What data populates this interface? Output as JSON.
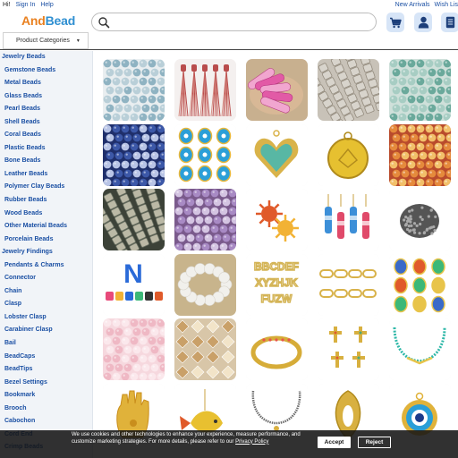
{
  "topbar": {
    "greeting": "Hi!",
    "sign_in": "Sign In",
    "help": "Help",
    "new_arrivals": "New Arrivals",
    "wish_list": "Wish Lis"
  },
  "header": {
    "logo_part1": "And",
    "logo_part2": "Bead",
    "search_placeholder": "",
    "icons": [
      "cart-icon",
      "user-icon",
      "order-list-icon"
    ]
  },
  "category_button": {
    "label": "Product Categories",
    "icon": "chevron-down-icon"
  },
  "sidebar": {
    "items": [
      {
        "label": "Jewelry Beads",
        "type": "group"
      },
      {
        "label": "Gemstone Beads",
        "type": "sub"
      },
      {
        "label": "Metal Beads",
        "type": "sub"
      },
      {
        "label": "Glass Beads",
        "type": "sub"
      },
      {
        "label": "Pearl Beads",
        "type": "sub"
      },
      {
        "label": "Shell Beads",
        "type": "sub"
      },
      {
        "label": "Coral Beads",
        "type": "sub"
      },
      {
        "label": "Plastic Beads",
        "type": "sub"
      },
      {
        "label": "Bone Beads",
        "type": "sub"
      },
      {
        "label": "Leather Beads",
        "type": "sub"
      },
      {
        "label": "Polymer Clay Beads",
        "type": "sub"
      },
      {
        "label": "Rubber Beads",
        "type": "sub"
      },
      {
        "label": "Wood Beads",
        "type": "sub"
      },
      {
        "label": "Other Material Beads",
        "type": "sub"
      },
      {
        "label": "Porcelain Beads",
        "type": "sub"
      },
      {
        "label": "Jewelry Findings",
        "type": "group"
      },
      {
        "label": "Pendants & Charms",
        "type": "sub"
      },
      {
        "label": "Connector",
        "type": "sub"
      },
      {
        "label": "Chain",
        "type": "sub"
      },
      {
        "label": "Clasp",
        "type": "sub"
      },
      {
        "label": "Lobster Clasp",
        "type": "sub"
      },
      {
        "label": "Carabiner Clasp",
        "type": "sub"
      },
      {
        "label": "Bail",
        "type": "sub"
      },
      {
        "label": "BeadCaps",
        "type": "sub"
      },
      {
        "label": "BeadTips",
        "type": "sub"
      },
      {
        "label": "Bezel Settings",
        "type": "sub"
      },
      {
        "label": "Bookmark",
        "type": "sub"
      },
      {
        "label": "Brooch",
        "type": "sub"
      },
      {
        "label": "Cabochon",
        "type": "sub"
      },
      {
        "label": "Cord End",
        "type": "sub"
      },
      {
        "label": "Crimp Beads",
        "type": "sub"
      }
    ]
  },
  "products": [
    {
      "kind": "beads",
      "bg": "#e9eef0",
      "c1": "#8fb3c2",
      "c2": "#b9cfd8"
    },
    {
      "kind": "tassels",
      "bg": "#f4f0ef",
      "c1": "#b94c4c",
      "c2": "#d78f86"
    },
    {
      "kind": "tubes",
      "bg": "#c8b08f",
      "c1": "#e25aa6",
      "c2": "#f1a6cf"
    },
    {
      "kind": "glass",
      "bg": "#c8c2b8",
      "c1": "#dad6cf",
      "c2": "#8e8678"
    },
    {
      "kind": "beads",
      "bg": "#cfe0da",
      "c1": "#6aa99b",
      "c2": "#a7cdc3"
    },
    {
      "kind": "beads",
      "bg": "#1f2f6b",
      "c1": "#3c58a8",
      "c2": "#b8c4e6"
    },
    {
      "kind": "charms",
      "bg": "#ffffff",
      "c1": "#2b9fd8",
      "c2": "#e8b73a"
    },
    {
      "kind": "heart",
      "bg": "#ffffff",
      "c1": "#d9b34a",
      "c2": "#58b7a4"
    },
    {
      "kind": "coin",
      "bg": "#ffffff",
      "c1": "#e6c030",
      "c2": "#b08a1c"
    },
    {
      "kind": "beads",
      "bg": "#b94b2c",
      "c1": "#e58a3c",
      "c2": "#f2c06a"
    },
    {
      "kind": "glass",
      "bg": "#3c4238",
      "c1": "#c9c6b2",
      "c2": "#6e7567"
    },
    {
      "kind": "beads",
      "bg": "#7a5a8c",
      "c1": "#a88ac4",
      "c2": "#d4c4e2"
    },
    {
      "kind": "sun",
      "bg": "#ffffff",
      "c1": "#e05a2a",
      "c2": "#f2b234"
    },
    {
      "kind": "bottles",
      "bg": "#ffffff",
      "c1": "#e04a6a",
      "c2": "#3c8fd8"
    },
    {
      "kind": "pave",
      "bg": "#ffffff",
      "c1": "#555555",
      "c2": "#a9a9a9"
    },
    {
      "kind": "letters",
      "bg": "#ffffff",
      "c1": "#2a6ad8",
      "c2": "#e84a7a"
    },
    {
      "kind": "pearls",
      "bg": "#c8b48c",
      "c1": "#f1f0ec",
      "c2": "#d8d4cc"
    },
    {
      "kind": "goldletters",
      "bg": "#ffffff",
      "c1": "#d4b456",
      "c2": "#8a7030"
    },
    {
      "kind": "links",
      "bg": "#ffffff",
      "c1": "#d8b24a",
      "c2": "#9a7a2a"
    },
    {
      "kind": "medals",
      "bg": "#ffffff",
      "c1": "#3a6ac8",
      "c2": "#e8c44a"
    },
    {
      "kind": "beads",
      "bg": "#f6d8de",
      "c1": "#efb8c4",
      "c2": "#fbe8ec"
    },
    {
      "kind": "crystals",
      "bg": "#d8c6a8",
      "c1": "#c9a068",
      "c2": "#f2e4c8"
    },
    {
      "kind": "bracelet",
      "bg": "#ffffff",
      "c1": "#d6ac38",
      "c2": "#e8554a"
    },
    {
      "kind": "crosses",
      "bg": "#ffffff",
      "c1": "#d8b040",
      "c2": "#4aa878"
    },
    {
      "kind": "necklace",
      "bg": "#ffffff",
      "c1": "#2fb8a8",
      "c2": "#e8c44a"
    },
    {
      "kind": "hand",
      "bg": "#ffffff",
      "c1": "#e0b23a",
      "c2": "#c98e1c"
    },
    {
      "kind": "fish",
      "bg": "#ffffff",
      "c1": "#e8c030",
      "c2": "#e05a2a"
    },
    {
      "kind": "seedneck",
      "bg": "#ffffff",
      "c1": "#6a6a6a",
      "c2": "#c8c8c8"
    },
    {
      "kind": "pendant",
      "bg": "#ffffff",
      "c1": "#d8b040",
      "c2": "#b08a1c"
    },
    {
      "kind": "eye",
      "bg": "#ffffff",
      "c1": "#2a9fd8",
      "c2": "#e0b23a"
    }
  ],
  "cookie": {
    "text": "We use cookies and other technologies to enhance your experience, measure performance, and customize marketing strategies. For more details, please refer to our",
    "link": "Privacy Policy",
    "accept": "Accept",
    "reject": "Reject"
  }
}
